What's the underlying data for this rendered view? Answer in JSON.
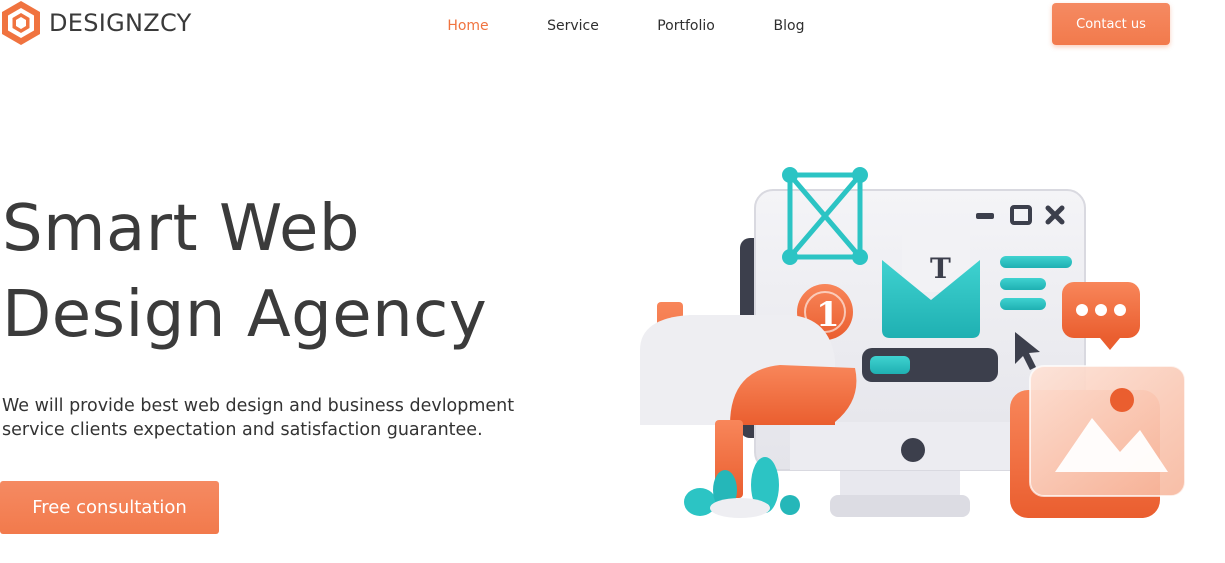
{
  "brand": {
    "name": "DESIGNZCY",
    "logo_icon": "hexagon-box-icon",
    "accent": "#f0733f"
  },
  "nav": {
    "items": [
      {
        "label": "Home",
        "active": true
      },
      {
        "label": "Service",
        "active": false
      },
      {
        "label": "Portfolio",
        "active": false
      },
      {
        "label": "Blog",
        "active": false
      }
    ]
  },
  "header": {
    "contact_label": "Contact us"
  },
  "hero": {
    "title_line1": "Smart Web",
    "title_line2": "Design Agency",
    "desc_line1": "We will provide best web design and business devlopment",
    "desc_line2": "service clients expectation and satisfaction guarantee.",
    "cta_label": "Free consultation",
    "illustration": {
      "icons": [
        "mailbox-icon",
        "envelope-icon",
        "monitor-icon",
        "chat-bubble-icon",
        "image-icon",
        "cursor-icon",
        "vector-frame-icon",
        "notification-badge-icon"
      ],
      "badge_text": "1",
      "envelope_letter": "T"
    }
  },
  "colors": {
    "orange": "#f0733f",
    "teal": "#2cc4c4",
    "dark": "#3a3a3a",
    "light": "#eeeef2"
  }
}
